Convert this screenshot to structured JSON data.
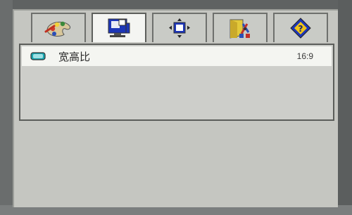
{
  "menu": {
    "tabs": [
      {
        "icon": "color-palette-icon",
        "active": false
      },
      {
        "icon": "monitor-display-icon",
        "active": true
      },
      {
        "icon": "position-adjust-icon",
        "active": false
      },
      {
        "icon": "setup-tools-icon",
        "active": false
      },
      {
        "icon": "help-question-icon",
        "active": false
      }
    ],
    "items": [
      {
        "icon": "aspect-ratio-icon",
        "label": "宽高比",
        "value": "16:9",
        "selected": true
      }
    ]
  },
  "colors": {
    "osd_background": "#c5c6c1",
    "highlight_row": "#f4f5f1",
    "monitor_blue": "#1d36b7",
    "help_yellow": "#f0c419"
  }
}
